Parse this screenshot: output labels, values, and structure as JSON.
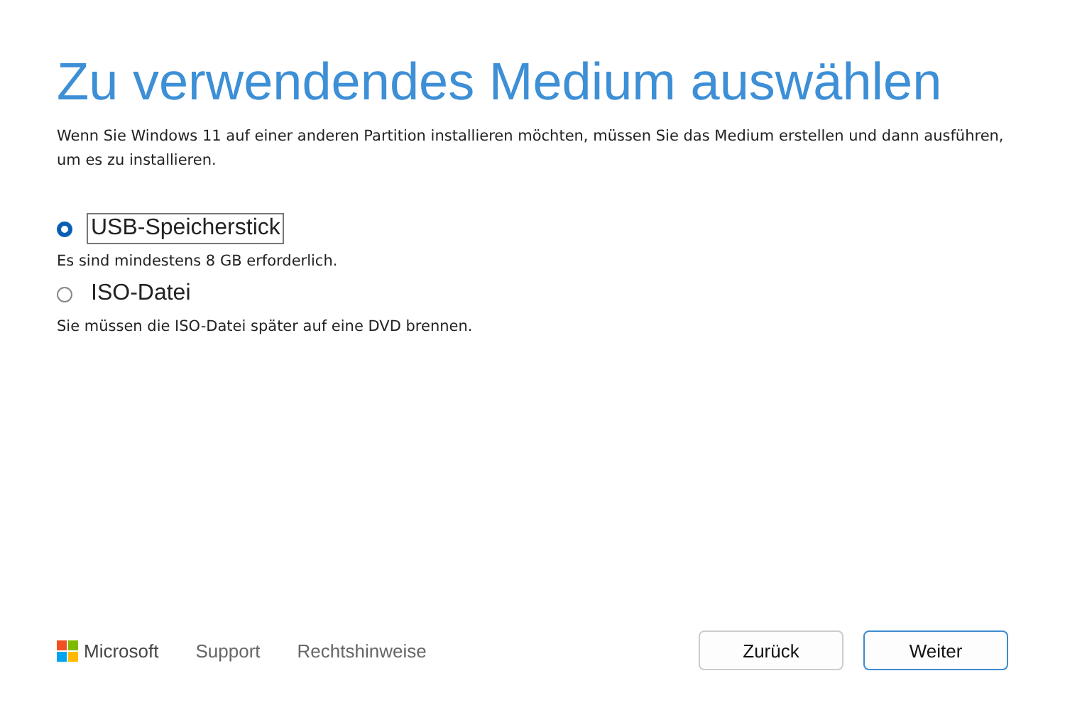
{
  "title": "Zu verwendendes Medium auswählen",
  "description": "Wenn Sie Windows 11 auf einer anderen Partition installieren möchten, müssen Sie das Medium erstellen und dann ausführen, um es zu installieren.",
  "options": [
    {
      "label": "USB-Speicherstick",
      "hint": "Es sind mindestens 8 GB erforderlich.",
      "selected": true,
      "focused": true
    },
    {
      "label": "ISO-Datei",
      "hint": "Sie müssen die ISO-Datei später auf eine DVD brennen.",
      "selected": false,
      "focused": false
    }
  ],
  "footer": {
    "brand": "Microsoft",
    "links": [
      "Support",
      "Rechtshinweise"
    ]
  },
  "buttons": [
    {
      "label": "Zurück",
      "default": false
    },
    {
      "label": "Weiter",
      "default": true
    }
  ]
}
